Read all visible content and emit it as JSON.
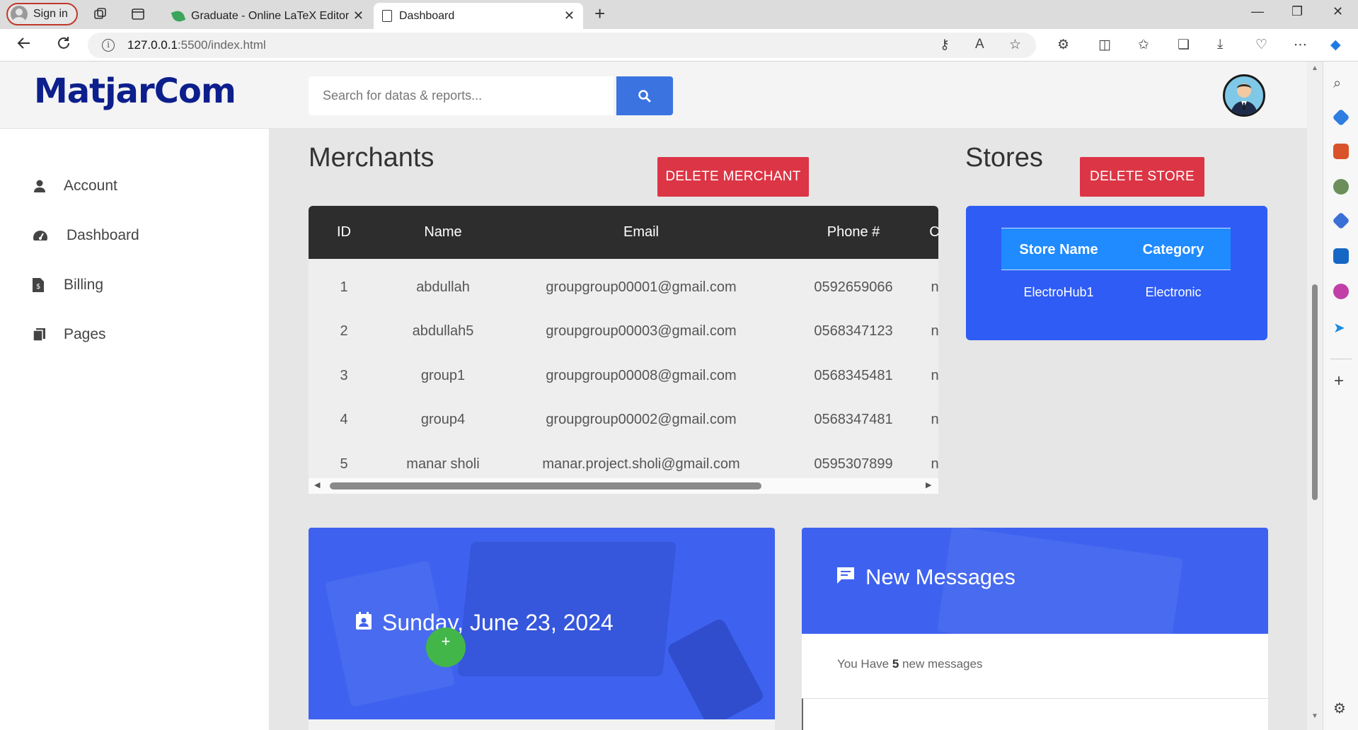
{
  "browser": {
    "signin_label": "Sign in",
    "tabs": [
      {
        "title": "Graduate - Online LaTeX Editor O",
        "active": false
      },
      {
        "title": "Dashboard",
        "active": true
      }
    ],
    "url_host": "127.0.0.1",
    "url_path": ":5500/index.html"
  },
  "app": {
    "logo": "MatjarCom",
    "search_placeholder": "Search for datas & reports...",
    "menu": [
      {
        "label": "Account",
        "icon": "user-icon"
      },
      {
        "label": "Dashboard",
        "icon": "dashboard-icon"
      },
      {
        "label": "Billing",
        "icon": "billing-icon"
      },
      {
        "label": "Pages",
        "icon": "pages-icon"
      }
    ]
  },
  "merchants": {
    "title": "Merchants",
    "delete_label": "DELETE MERCHANT",
    "columns": [
      "ID",
      "Name",
      "Email",
      "Phone #",
      "Ca"
    ],
    "rows": [
      {
        "id": "1",
        "name": "abdullah",
        "email": "groupgroup00001@gmail.com",
        "phone": "0592659066",
        "cat": "nc"
      },
      {
        "id": "2",
        "name": "abdullah5",
        "email": "groupgroup00003@gmail.com",
        "phone": "0568347123",
        "cat": "nc"
      },
      {
        "id": "3",
        "name": "group1",
        "email": "groupgroup00008@gmail.com",
        "phone": "0568345481",
        "cat": "nc"
      },
      {
        "id": "4",
        "name": "group4",
        "email": "groupgroup00002@gmail.com",
        "phone": "0568347481",
        "cat": "nc"
      },
      {
        "id": "5",
        "name": "manar sholi",
        "email": "manar.project.sholi@gmail.com",
        "phone": "0595307899",
        "cat": "nc"
      }
    ]
  },
  "stores": {
    "title": "Stores",
    "delete_label": "DELETE STORE",
    "columns": [
      "Store Name",
      "Category"
    ],
    "rows": [
      {
        "name": "ElectroHub1",
        "category": "Electronic"
      }
    ]
  },
  "date_card": {
    "date": "Sunday, June 23, 2024",
    "fab_label": "+"
  },
  "messages": {
    "title": "New Messages",
    "prefix": "You Have",
    "count": "5",
    "suffix": "new messages"
  },
  "colors": {
    "primary_blue": "#3e62ef",
    "danger": "#dc3545",
    "logo": "#0d1f8c",
    "table_header": "#2d2d2d"
  }
}
